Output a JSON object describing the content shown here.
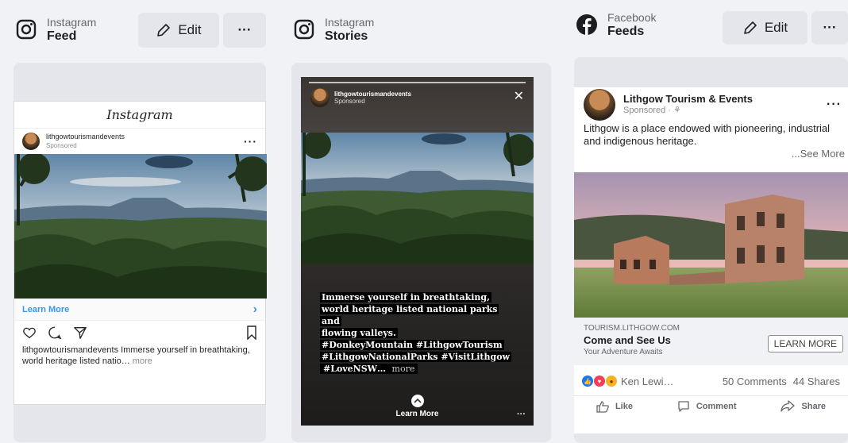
{
  "columns": [
    {
      "placement_kind": "Instagram",
      "placement_name": "Feed",
      "edit_label": "Edit",
      "more_label": "···"
    },
    {
      "placement_kind": "Instagram",
      "placement_name": "Stories"
    },
    {
      "placement_kind": "Facebook",
      "placement_name": "Feeds",
      "edit_label": "Edit",
      "more_label": "···"
    }
  ],
  "instagram_feed": {
    "app_logo_text": "Instagram",
    "account": "lithgowtourismandevents",
    "sponsored": "Sponsored",
    "more": "···",
    "cta": "Learn More",
    "cta_chevron": "›",
    "caption_account": "lithgowtourismandevents",
    "caption_text": " Immerse yourself in breathtaking, world heritage listed natio…",
    "caption_more": " more"
  },
  "instagram_story": {
    "account": "lithgowtourismandevents",
    "sponsored": "Sponsored",
    "close": "✕",
    "caption_l1": "Immerse yourself in breathtaking,",
    "caption_l2": "world heritage listed national parks and",
    "caption_l3": "flowing valleys.",
    "caption_l4": "#DonkeyMountain #LithgowTourism",
    "caption_l5": "#LithgowNationalParks #VisitLithgow",
    "caption_l6": "#LoveNSW…",
    "caption_more": " more",
    "cta": "Learn More",
    "more": "···"
  },
  "facebook_feed": {
    "page_name": "Lithgow Tourism & Events",
    "sponsored": "Sponsored · ⚘",
    "more": "···",
    "body": "Lithgow is a place endowed with pioneering, industrial and indigenous heritage.",
    "see_more": "...See More",
    "link_domain": "TOURISM.LITHGOW.COM",
    "link_title": "Come and See Us",
    "link_subtitle": "Your Adventure Awaits",
    "cta": "LEARN MORE",
    "reactions_names": "Ken Lewi…",
    "comments": "50 Comments",
    "shares": "44 Shares",
    "like": "Like",
    "comment": "Comment",
    "share": "Share"
  },
  "icons": [
    "instagram-icon",
    "facebook-icon",
    "pencil-icon",
    "heart-icon",
    "comment-icon",
    "send-icon",
    "bookmark-icon",
    "like-icon",
    "share-icon"
  ],
  "colors": {
    "background": "#f0f2f5",
    "button": "#e4e6eb",
    "ig_link": "#3897f0",
    "fb_blue": "#1877f2"
  }
}
